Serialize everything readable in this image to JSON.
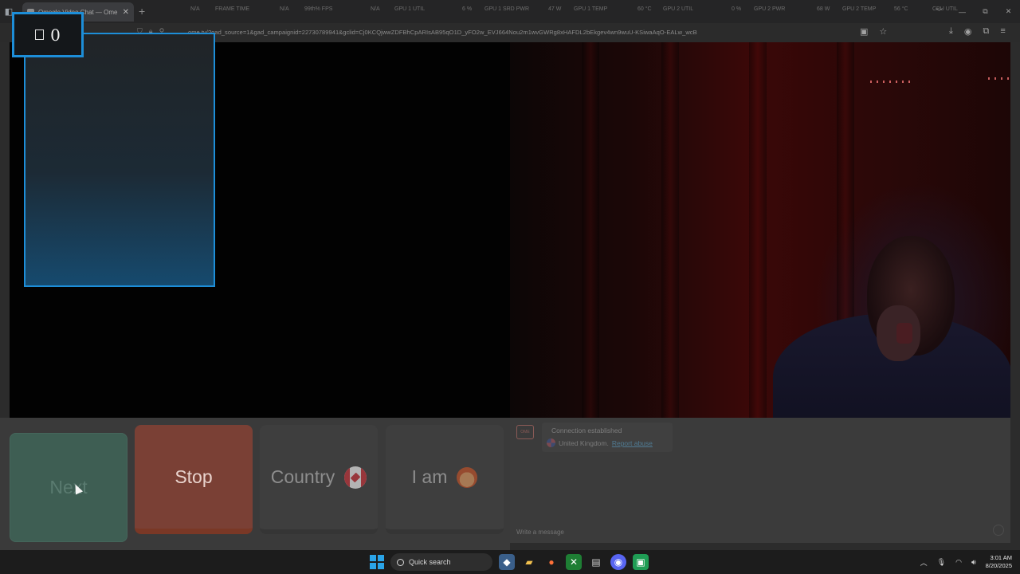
{
  "browser": {
    "tab_title": "Omegle Video Chat — Ome",
    "tab_close": "✕",
    "new_tab": "+",
    "url": "ome.tv/?gad_source=1&gad_campaignid=22730789941&gclid=Cj0KCQjwwZDFBhCpARIsAB95qO1D_yFO2w_EVJ664Nou2m1wvGWRg8xHAFDL2bEkgev4wn9wuU-KSiwaAqO-EALw_wcB",
    "window_controls": [
      "﹀",
      "—",
      "⧉",
      "✕"
    ]
  },
  "hud_overlay": {
    "frametime_value": "N/A",
    "frametime_label": "FRAME TIME",
    "fps_na": "N/A",
    "fps_label": "99th% FPS",
    "gpu1_util_value": "N/A",
    "gpu1_util_label": "GPU 1 UTIL",
    "gpu1_srd_value": "6 %",
    "gpu1_srd_label": "GPU 1 SRD PWR",
    "gpu1_temp_value": "47 W",
    "gpu1_temp_label": "GPU 1 TEMP",
    "gpu2_util_value": "60 °C",
    "gpu2_util_label": "GPU 2 UTIL",
    "gpu2_pwr_value": "0 %",
    "gpu2_pwr_label": "GPU 2 PWR",
    "gpu2_temp_value": "68 W",
    "gpu2_temp_label": "GPU 2 TEMP",
    "cpu_value": "56 °C",
    "cpu_label": "CPU UTIL"
  },
  "counter": {
    "value": "0"
  },
  "controls": {
    "next_label": "Next",
    "stop_label": "Stop",
    "country_label": "Country",
    "iam_label": "I am"
  },
  "chat": {
    "logo_text": "OME",
    "connection_status": "Connection established",
    "partner_country": "United Kingdom.",
    "report_link": "Report abuse",
    "message_placeholder": "Write a message"
  },
  "taskbar": {
    "search_label": "Quick search",
    "time": "3:01 AM",
    "date": "8/20/2025"
  },
  "colors": {
    "accent_blue": "#1d8ed8",
    "next_green": "#3e5e53",
    "stop_orange": "#7a4035"
  }
}
